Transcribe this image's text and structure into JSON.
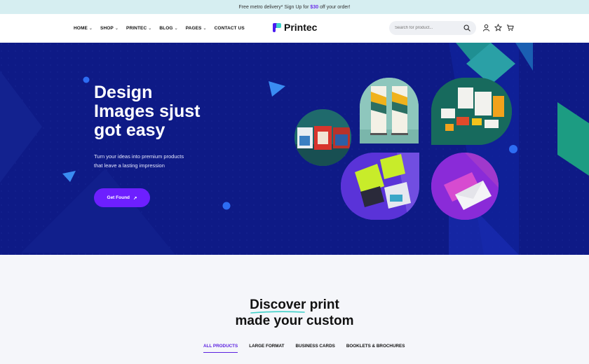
{
  "announcement": {
    "before": "Free metro delivery* Sign Up for",
    "promo": "$30",
    "after": "off your order!"
  },
  "nav": {
    "items": [
      {
        "label": "HOME",
        "has_dropdown": true
      },
      {
        "label": "SHOP",
        "has_dropdown": true
      },
      {
        "label": "PRINTEC",
        "has_dropdown": true
      },
      {
        "label": "BLOG",
        "has_dropdown": true
      },
      {
        "label": "PAGES",
        "has_dropdown": true
      },
      {
        "label": "CONTACT US",
        "has_dropdown": false
      }
    ],
    "chevron": "⌄"
  },
  "logo": {
    "text": "Printec"
  },
  "search": {
    "placeholder": "Search for product..."
  },
  "header_icons": [
    "user-icon",
    "star-icon",
    "cart-icon"
  ],
  "hero": {
    "title_lines": [
      "Design",
      "Images sjust",
      "got easy"
    ],
    "subtitle_lines": [
      "Turn your ideas into premium products",
      "that leave a lasting impression"
    ],
    "cta_label": "Get Found",
    "cta_arrow": "↗"
  },
  "discover": {
    "title_lines": [
      "Discover print",
      "made your custom"
    ],
    "tabs": [
      {
        "label": "ALL PRODUCTS",
        "active": true
      },
      {
        "label": "LARGE FORMAT",
        "active": false
      },
      {
        "label": "BUSINESS CARDS",
        "active": false
      },
      {
        "label": "BOOKLETS & BROCHURES",
        "active": false
      }
    ]
  },
  "colors": {
    "accent": "#6d1fff",
    "hero_bg": "#0e1a86",
    "topbar_bg": "#d6eef1",
    "teal": "#3fd0c9"
  }
}
